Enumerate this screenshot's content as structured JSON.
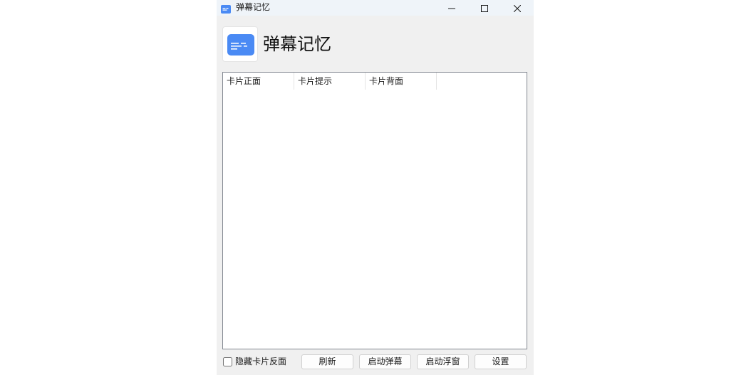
{
  "window": {
    "title": "弹幕记忆",
    "icon": "app-icon",
    "controls": {
      "minimize": "minimize-icon",
      "maximize": "maximize-icon",
      "close": "close-icon"
    }
  },
  "header": {
    "icon": "danmaku-app-icon",
    "title": "弹幕记忆"
  },
  "card_table": {
    "columns": [
      "卡片正面",
      "卡片提示",
      "卡片背面"
    ],
    "rows": []
  },
  "footer": {
    "hide_back": {
      "label": "隐藏卡片反面",
      "checked": false
    },
    "buttons": {
      "refresh": "刷新",
      "start_danmaku": "启动弹幕",
      "start_floating": "启动浮窗",
      "settings": "设置"
    }
  },
  "colors": {
    "accent": "#4a8af4",
    "window_bg": "#f0f0f0",
    "titlebar_bg": "#eff4f9",
    "list_border": "#828790"
  }
}
